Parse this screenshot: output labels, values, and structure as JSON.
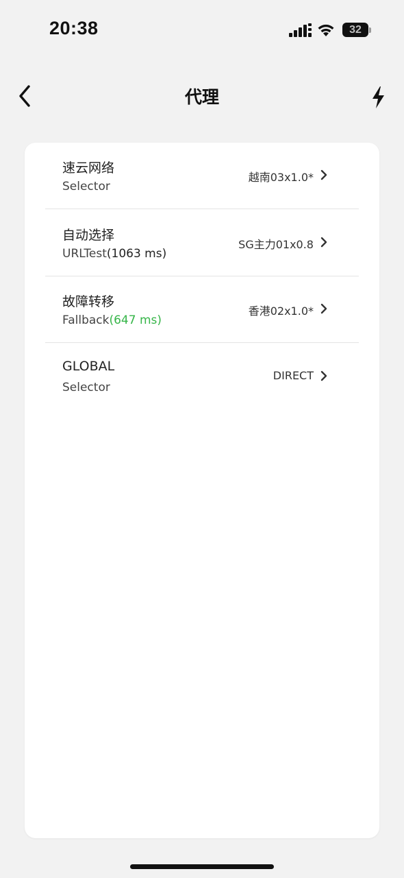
{
  "status_bar": {
    "time": "20:38",
    "battery_level": "32",
    "icons": [
      "signal-icon",
      "wifi-icon",
      "battery-icon"
    ]
  },
  "nav": {
    "title": "代理",
    "back_icon": "chevron-left-icon",
    "action_icon": "lightning-bolt-icon"
  },
  "proxy_groups": [
    {
      "name": "速云网络",
      "type": "Selector",
      "delay": "",
      "selected": "越南03x1.0*"
    },
    {
      "name": "自动选择",
      "type": "URLTest",
      "delay": "(1063 ms)",
      "selected": "SG主力01x0.8"
    },
    {
      "name": "故障转移",
      "type": "Fallback",
      "delay": "(647 ms)",
      "selected": "香港02x1.0*"
    },
    {
      "name": "GLOBAL",
      "type": "Selector",
      "delay": "",
      "selected": "DIRECT"
    }
  ],
  "colors": {
    "background": "#f2f2f2",
    "card": "#ffffff",
    "delay_good": "#35b548"
  }
}
